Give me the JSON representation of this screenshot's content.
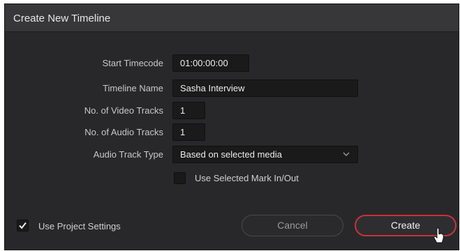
{
  "dialog": {
    "title": "Create New Timeline"
  },
  "form": {
    "start_timecode": {
      "label": "Start Timecode",
      "value": "01:00:00:00"
    },
    "timeline_name": {
      "label": "Timeline Name",
      "value": "Sasha Interview"
    },
    "video_tracks": {
      "label": "No. of Video Tracks",
      "value": "1"
    },
    "audio_tracks": {
      "label": "No. of Audio Tracks",
      "value": "1"
    },
    "audio_track_type": {
      "label": "Audio Track Type",
      "value": "Based on selected media"
    },
    "use_mark_in_out": {
      "label": "Use Selected Mark In/Out",
      "checked": false
    }
  },
  "footer": {
    "use_project_settings": {
      "label": "Use Project Settings",
      "checked": true
    },
    "cancel_label": "Cancel",
    "create_label": "Create"
  },
  "icons": {
    "dropdown": "chevron-down-icon",
    "check": "checkmark-icon",
    "cursor": "mouse-pointer-icon"
  },
  "colors": {
    "dialog_bg": "#28282a",
    "titlebar_bg": "#37373a",
    "field_bg": "#1a1a1b",
    "accent_red": "#c8323a"
  }
}
